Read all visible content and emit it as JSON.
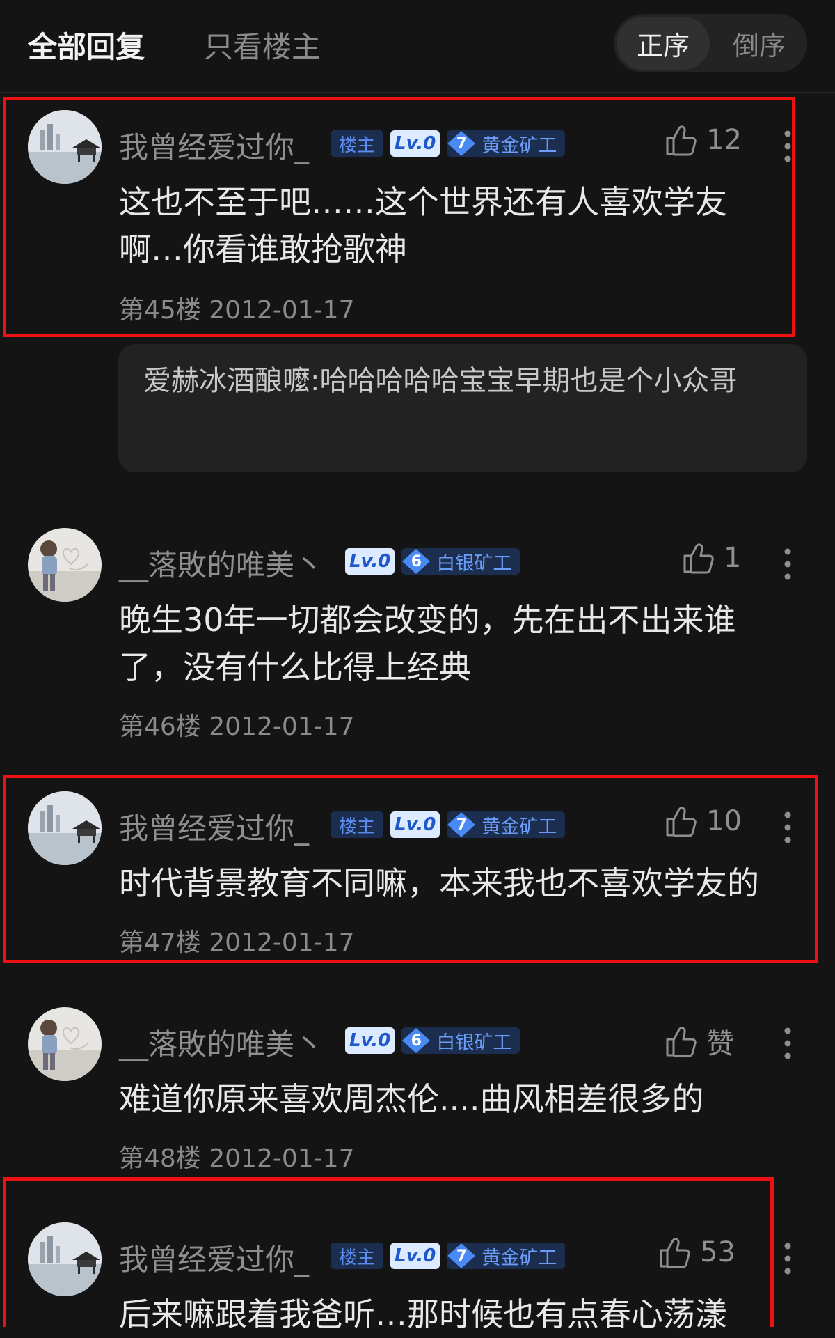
{
  "header": {
    "tab_all": "全部回复",
    "tab_owner_only": "只看楼主",
    "order_asc": "正序",
    "order_desc": "倒序"
  },
  "posts": [
    {
      "username": "我曾经爱过你_",
      "owner_badge": "楼主",
      "level": "Lv.0",
      "rank_num": "7",
      "rank_name": "黄金矿工",
      "likes": "12",
      "content_lines": [
        "这也不至于吧……这个世界还有人喜欢学友",
        "啊…你看谁敢抢歌神"
      ],
      "floor": "第45楼",
      "date": "2012-01-17"
    },
    {
      "username": "__落敗的唯美丶",
      "level": "Lv.0",
      "rank_num": "6",
      "rank_name": "白银矿工",
      "likes": "1",
      "content_lines": [
        "晚生30年一切都会改变的，先在出不出来谁",
        "了，没有什么比得上经典"
      ],
      "floor": "第46楼",
      "date": "2012-01-17"
    },
    {
      "username": "我曾经爱过你_",
      "owner_badge": "楼主",
      "level": "Lv.0",
      "rank_num": "7",
      "rank_name": "黄金矿工",
      "likes": "10",
      "content_lines": [
        "时代背景教育不同嘛，本来我也不喜欢学友的"
      ],
      "floor": "第47楼",
      "date": "2012-01-17"
    },
    {
      "username": "__落敗的唯美丶",
      "level": "Lv.0",
      "rank_num": "6",
      "rank_name": "白银矿工",
      "likes": "赞",
      "content_lines": [
        "难道你原来喜欢周杰伦....曲风相差很多的"
      ],
      "floor": "第48楼",
      "date": "2012-01-17"
    },
    {
      "username": "我曾经爱过你_",
      "owner_badge": "楼主",
      "level": "Lv.0",
      "rank_num": "7",
      "rank_name": "黄金矿工",
      "likes": "53",
      "content_lines": [
        "后来嘛跟着我爸听…那时候也有点春心荡漾"
      ]
    }
  ],
  "reply": {
    "author": "爱赫冰酒酿嚒",
    "text": ":哈哈哈哈哈宝宝早期也是个小众哥"
  },
  "colors": {
    "background": "#141414",
    "highlight_box": "#ee1111",
    "badge_blue": "#5b8cf0",
    "gem_blue": "#4a8af4"
  }
}
